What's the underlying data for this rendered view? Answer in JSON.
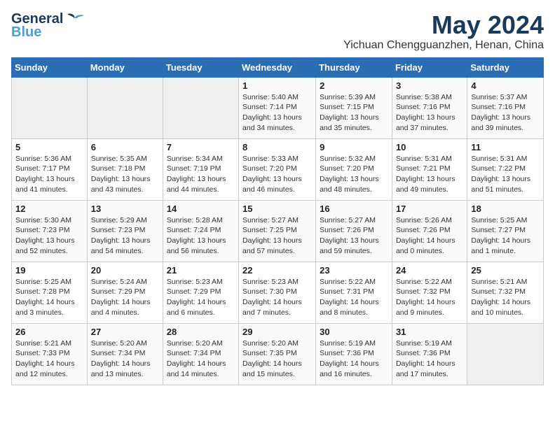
{
  "header": {
    "logo_line1": "General",
    "logo_line2": "Blue",
    "month_year": "May 2024",
    "location": "Yichuan Chengguanzhen, Henan, China"
  },
  "weekdays": [
    "Sunday",
    "Monday",
    "Tuesday",
    "Wednesday",
    "Thursday",
    "Friday",
    "Saturday"
  ],
  "weeks": [
    [
      {
        "day": "",
        "sunrise": "",
        "sunset": "",
        "daylight": ""
      },
      {
        "day": "",
        "sunrise": "",
        "sunset": "",
        "daylight": ""
      },
      {
        "day": "",
        "sunrise": "",
        "sunset": "",
        "daylight": ""
      },
      {
        "day": "1",
        "sunrise": "Sunrise: 5:40 AM",
        "sunset": "Sunset: 7:14 PM",
        "daylight": "Daylight: 13 hours and 34 minutes."
      },
      {
        "day": "2",
        "sunrise": "Sunrise: 5:39 AM",
        "sunset": "Sunset: 7:15 PM",
        "daylight": "Daylight: 13 hours and 35 minutes."
      },
      {
        "day": "3",
        "sunrise": "Sunrise: 5:38 AM",
        "sunset": "Sunset: 7:16 PM",
        "daylight": "Daylight: 13 hours and 37 minutes."
      },
      {
        "day": "4",
        "sunrise": "Sunrise: 5:37 AM",
        "sunset": "Sunset: 7:16 PM",
        "daylight": "Daylight: 13 hours and 39 minutes."
      }
    ],
    [
      {
        "day": "5",
        "sunrise": "Sunrise: 5:36 AM",
        "sunset": "Sunset: 7:17 PM",
        "daylight": "Daylight: 13 hours and 41 minutes."
      },
      {
        "day": "6",
        "sunrise": "Sunrise: 5:35 AM",
        "sunset": "Sunset: 7:18 PM",
        "daylight": "Daylight: 13 hours and 43 minutes."
      },
      {
        "day": "7",
        "sunrise": "Sunrise: 5:34 AM",
        "sunset": "Sunset: 7:19 PM",
        "daylight": "Daylight: 13 hours and 44 minutes."
      },
      {
        "day": "8",
        "sunrise": "Sunrise: 5:33 AM",
        "sunset": "Sunset: 7:20 PM",
        "daylight": "Daylight: 13 hours and 46 minutes."
      },
      {
        "day": "9",
        "sunrise": "Sunrise: 5:32 AM",
        "sunset": "Sunset: 7:20 PM",
        "daylight": "Daylight: 13 hours and 48 minutes."
      },
      {
        "day": "10",
        "sunrise": "Sunrise: 5:31 AM",
        "sunset": "Sunset: 7:21 PM",
        "daylight": "Daylight: 13 hours and 49 minutes."
      },
      {
        "day": "11",
        "sunrise": "Sunrise: 5:31 AM",
        "sunset": "Sunset: 7:22 PM",
        "daylight": "Daylight: 13 hours and 51 minutes."
      }
    ],
    [
      {
        "day": "12",
        "sunrise": "Sunrise: 5:30 AM",
        "sunset": "Sunset: 7:23 PM",
        "daylight": "Daylight: 13 hours and 52 minutes."
      },
      {
        "day": "13",
        "sunrise": "Sunrise: 5:29 AM",
        "sunset": "Sunset: 7:23 PM",
        "daylight": "Daylight: 13 hours and 54 minutes."
      },
      {
        "day": "14",
        "sunrise": "Sunrise: 5:28 AM",
        "sunset": "Sunset: 7:24 PM",
        "daylight": "Daylight: 13 hours and 56 minutes."
      },
      {
        "day": "15",
        "sunrise": "Sunrise: 5:27 AM",
        "sunset": "Sunset: 7:25 PM",
        "daylight": "Daylight: 13 hours and 57 minutes."
      },
      {
        "day": "16",
        "sunrise": "Sunrise: 5:27 AM",
        "sunset": "Sunset: 7:26 PM",
        "daylight": "Daylight: 13 hours and 59 minutes."
      },
      {
        "day": "17",
        "sunrise": "Sunrise: 5:26 AM",
        "sunset": "Sunset: 7:26 PM",
        "daylight": "Daylight: 14 hours and 0 minutes."
      },
      {
        "day": "18",
        "sunrise": "Sunrise: 5:25 AM",
        "sunset": "Sunset: 7:27 PM",
        "daylight": "Daylight: 14 hours and 1 minute."
      }
    ],
    [
      {
        "day": "19",
        "sunrise": "Sunrise: 5:25 AM",
        "sunset": "Sunset: 7:28 PM",
        "daylight": "Daylight: 14 hours and 3 minutes."
      },
      {
        "day": "20",
        "sunrise": "Sunrise: 5:24 AM",
        "sunset": "Sunset: 7:29 PM",
        "daylight": "Daylight: 14 hours and 4 minutes."
      },
      {
        "day": "21",
        "sunrise": "Sunrise: 5:23 AM",
        "sunset": "Sunset: 7:29 PM",
        "daylight": "Daylight: 14 hours and 6 minutes."
      },
      {
        "day": "22",
        "sunrise": "Sunrise: 5:23 AM",
        "sunset": "Sunset: 7:30 PM",
        "daylight": "Daylight: 14 hours and 7 minutes."
      },
      {
        "day": "23",
        "sunrise": "Sunrise: 5:22 AM",
        "sunset": "Sunset: 7:31 PM",
        "daylight": "Daylight: 14 hours and 8 minutes."
      },
      {
        "day": "24",
        "sunrise": "Sunrise: 5:22 AM",
        "sunset": "Sunset: 7:32 PM",
        "daylight": "Daylight: 14 hours and 9 minutes."
      },
      {
        "day": "25",
        "sunrise": "Sunrise: 5:21 AM",
        "sunset": "Sunset: 7:32 PM",
        "daylight": "Daylight: 14 hours and 10 minutes."
      }
    ],
    [
      {
        "day": "26",
        "sunrise": "Sunrise: 5:21 AM",
        "sunset": "Sunset: 7:33 PM",
        "daylight": "Daylight: 14 hours and 12 minutes."
      },
      {
        "day": "27",
        "sunrise": "Sunrise: 5:20 AM",
        "sunset": "Sunset: 7:34 PM",
        "daylight": "Daylight: 14 hours and 13 minutes."
      },
      {
        "day": "28",
        "sunrise": "Sunrise: 5:20 AM",
        "sunset": "Sunset: 7:34 PM",
        "daylight": "Daylight: 14 hours and 14 minutes."
      },
      {
        "day": "29",
        "sunrise": "Sunrise: 5:20 AM",
        "sunset": "Sunset: 7:35 PM",
        "daylight": "Daylight: 14 hours and 15 minutes."
      },
      {
        "day": "30",
        "sunrise": "Sunrise: 5:19 AM",
        "sunset": "Sunset: 7:36 PM",
        "daylight": "Daylight: 14 hours and 16 minutes."
      },
      {
        "day": "31",
        "sunrise": "Sunrise: 5:19 AM",
        "sunset": "Sunset: 7:36 PM",
        "daylight": "Daylight: 14 hours and 17 minutes."
      },
      {
        "day": "",
        "sunrise": "",
        "sunset": "",
        "daylight": ""
      }
    ]
  ]
}
